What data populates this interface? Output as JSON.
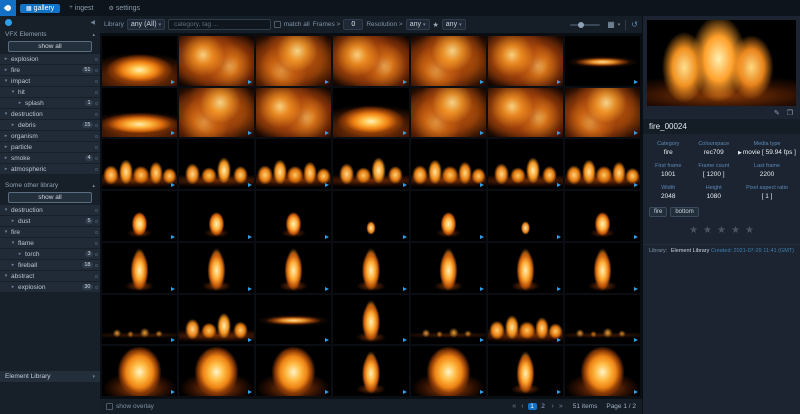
{
  "theme": {
    "accent": "#2e9fe8",
    "tab_active": "#1272c4",
    "panel_bg": "#1b2430",
    "sidebar_bg": "#171f29"
  },
  "topbar": {
    "tabs": [
      {
        "label": "gallery",
        "active": true
      },
      {
        "label": "ingest",
        "active": false
      },
      {
        "label": "settings",
        "active": false
      }
    ]
  },
  "sidebar": {
    "sections": [
      {
        "title": "VFX Elements",
        "show_all": "show all",
        "items": [
          {
            "label": "explosion",
            "depth": 0,
            "expanded": false,
            "count": ""
          },
          {
            "label": "fire",
            "depth": 0,
            "expanded": false,
            "count": "51"
          },
          {
            "label": "impact",
            "depth": 0,
            "expanded": true,
            "count": ""
          },
          {
            "label": "hit",
            "depth": 1,
            "expanded": true,
            "count": ""
          },
          {
            "label": "splash",
            "depth": 2,
            "expanded": false,
            "count": "1"
          },
          {
            "label": "destruction",
            "depth": 0,
            "expanded": true,
            "count": ""
          },
          {
            "label": "debris",
            "depth": 1,
            "expanded": false,
            "count": "15"
          },
          {
            "label": "organism",
            "depth": 0,
            "expanded": false,
            "count": ""
          },
          {
            "label": "particle",
            "depth": 0,
            "expanded": false,
            "count": ""
          },
          {
            "label": "smoke",
            "depth": 0,
            "expanded": false,
            "count": "4"
          },
          {
            "label": "atmospheric",
            "depth": 0,
            "expanded": false,
            "count": ""
          }
        ]
      },
      {
        "title": "Some other library",
        "show_all": "show all",
        "items": [
          {
            "label": "destruction",
            "depth": 0,
            "expanded": true,
            "count": ""
          },
          {
            "label": "dust",
            "depth": 1,
            "expanded": false,
            "count": "5"
          },
          {
            "label": "fire",
            "depth": 0,
            "expanded": true,
            "count": ""
          },
          {
            "label": "flame",
            "depth": 1,
            "expanded": true,
            "count": ""
          },
          {
            "label": "torch",
            "depth": 2,
            "expanded": false,
            "count": "3"
          },
          {
            "label": "fireball",
            "depth": 1,
            "expanded": false,
            "count": "18"
          },
          {
            "label": "abstract",
            "depth": 0,
            "expanded": true,
            "count": ""
          },
          {
            "label": "explosion",
            "depth": 1,
            "expanded": false,
            "count": "30"
          }
        ]
      }
    ],
    "footer": {
      "label": "Element Library"
    }
  },
  "toolbar": {
    "library_label": "Library",
    "library_value": "any (All)",
    "search_placeholder": "category, tag ...",
    "match_all_label": "match all",
    "frames_label": "Frames >",
    "frames_value": "0",
    "resolution_label": "Resolution >",
    "resolution_value": "any",
    "rating_value": "any"
  },
  "grid": {
    "columns": 7,
    "items": [
      "burst-wide",
      "fireball-a",
      "fireball-b",
      "fireball-a",
      "fireball-b",
      "fireball-a",
      "ember-streak",
      "burst-low",
      "fireball-b",
      "fireball-a",
      "burst-wide",
      "fireball-b",
      "fireball-a",
      "fireball-b",
      "fire-line",
      "fire-line-b",
      "fire-line",
      "fire-line-b",
      "fire-line",
      "fire-line-b",
      "fire-line",
      "flame-small",
      "flame-small",
      "flame-small",
      "flame-tiny",
      "flame-small",
      "flame-tiny",
      "flame-small",
      "flame-tall",
      "flame-tall",
      "flame-tall",
      "flame-tall",
      "flame-tall",
      "flame-tall",
      "flame-tall",
      "fire-line-dim",
      "fire-line-b",
      "ember-streak",
      "flame-tall",
      "fire-line-dim",
      "fire-line",
      "fire-line-dim",
      "flame-big",
      "flame-big",
      "flame-big",
      "flame-tall",
      "flame-big",
      "flame-tall",
      "flame-big"
    ]
  },
  "details": {
    "title": "fire_00024",
    "fields": [
      {
        "label": "Category",
        "value": "fire"
      },
      {
        "label": "Colourspace",
        "value": "rec709"
      },
      {
        "label": "Media type",
        "value": "movie [ 59.94 fps ]",
        "icon": "movie-icon"
      },
      {
        "label": "First frame",
        "value": "1001"
      },
      {
        "label": "Frame count",
        "value": "[ 1200 ]"
      },
      {
        "label": "Last frame",
        "value": "2200"
      },
      {
        "label": "Width",
        "value": "2048"
      },
      {
        "label": "Height",
        "value": "1080"
      },
      {
        "label": "Pixel aspect ratio",
        "value": "[ 1 ]"
      }
    ],
    "tags": [
      "fire",
      "bottom"
    ],
    "rating_stars": 5,
    "library_label": "Library:",
    "library_value": "Element Library",
    "created": "Created: 2021-07-29 11:41 (GMT)"
  },
  "footer": {
    "show_overlay_label": "show overlay",
    "pages": [
      "1",
      "2"
    ],
    "active_page": "1",
    "items_text": "51 items",
    "page_text": "Page 1 / 2"
  }
}
